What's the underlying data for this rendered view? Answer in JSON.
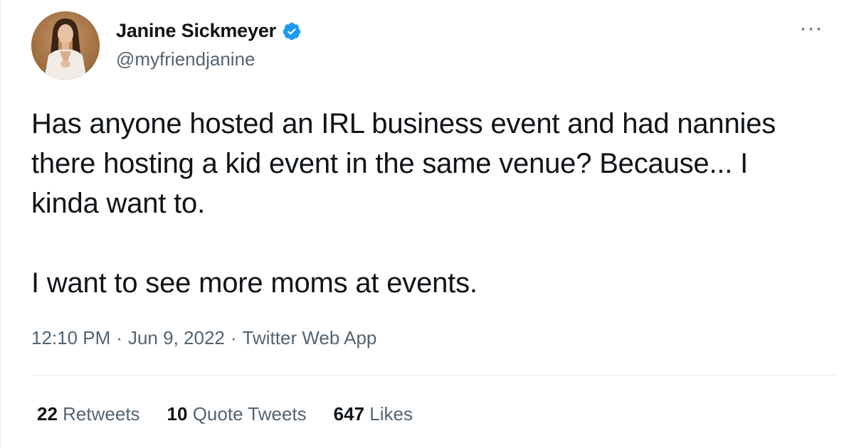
{
  "author": {
    "display_name": "Janine Sickmeyer",
    "handle": "@myfriendjanine",
    "verified": true
  },
  "tweet": {
    "paragraphs": [
      "Has anyone hosted an IRL business event and had nannies there hosting a kid event in the same venue? Because... I kinda want to.",
      "I want to see more moms at events."
    ],
    "time": "12:10 PM",
    "separator": "·",
    "date": "Jun 9, 2022",
    "source": "Twitter Web App"
  },
  "stats": {
    "retweets": {
      "count": "22",
      "label": "Retweets"
    },
    "quotes": {
      "count": "10",
      "label": "Quote Tweets"
    },
    "likes": {
      "count": "647",
      "label": "Likes"
    }
  },
  "more_button": {
    "label": "···"
  },
  "colors": {
    "text": "#0f1419",
    "secondary": "#536471",
    "verified": "#1d9bf0",
    "divider": "#e6ecf0"
  },
  "icons": {
    "verified": "verified-badge-icon",
    "more": "more-options-icon"
  }
}
